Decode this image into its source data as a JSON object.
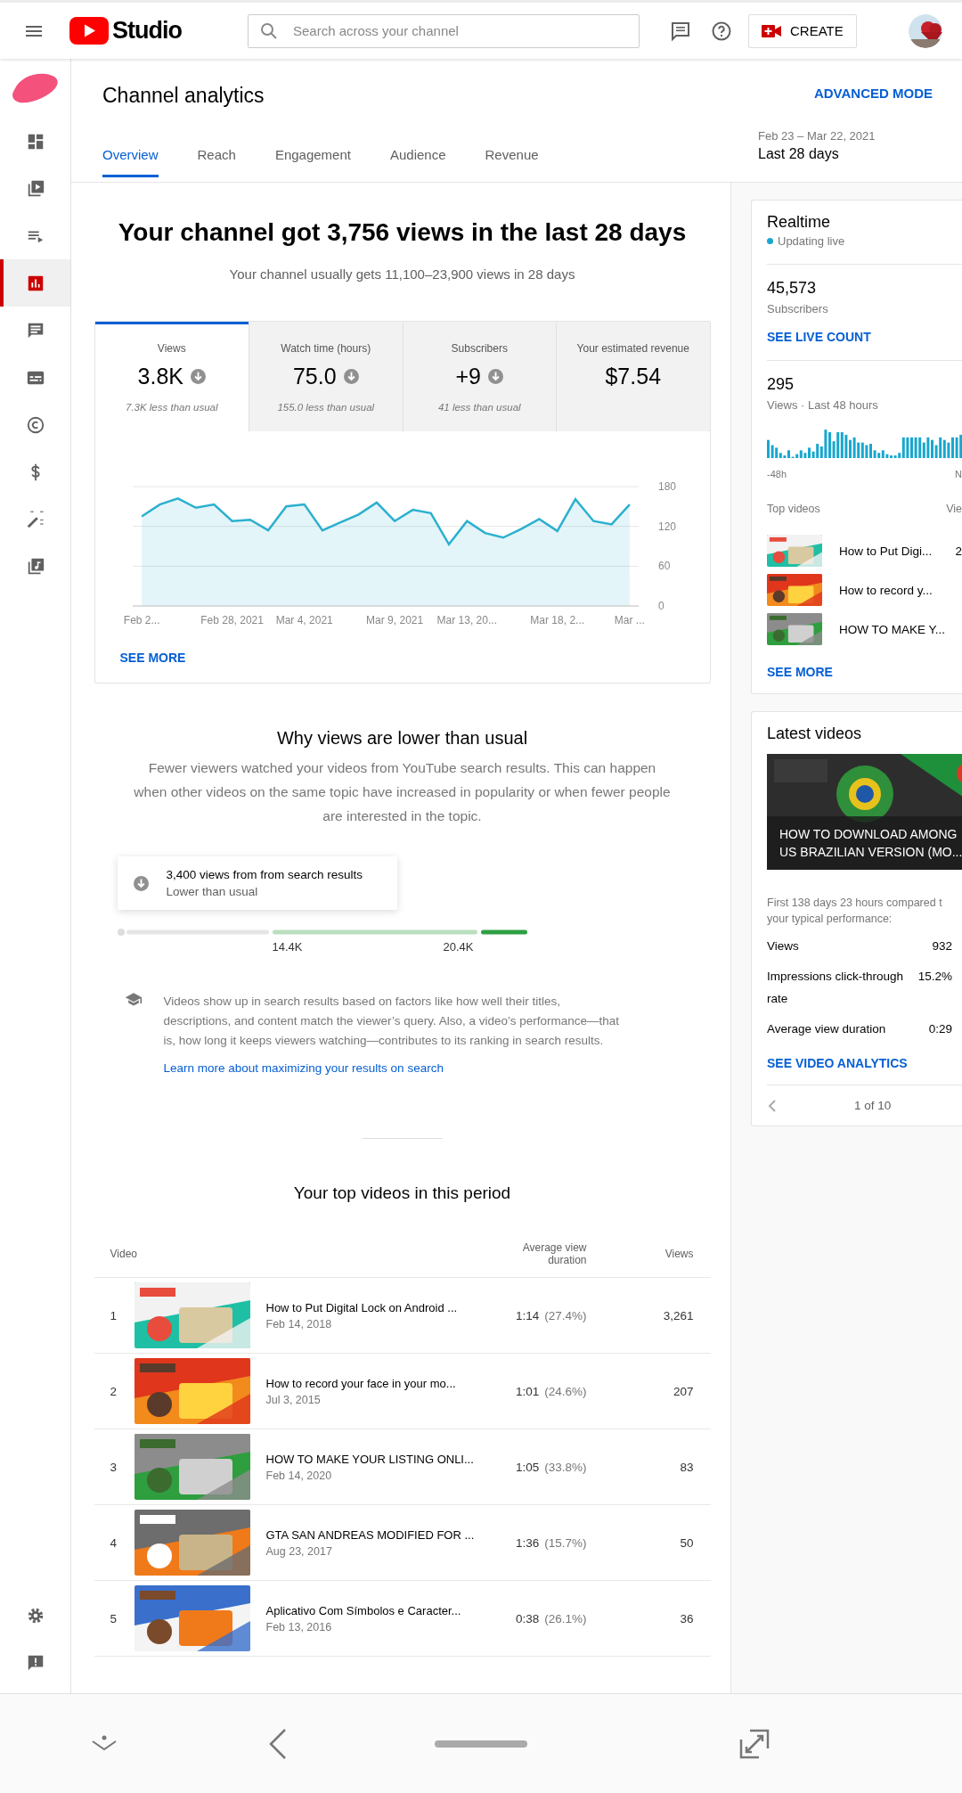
{
  "header": {
    "logo_text": "Studio",
    "search": {
      "placeholder": "Search across your channel"
    },
    "create_button": "CREATE"
  },
  "sidebar": {
    "items": [
      {
        "kind": "dashboard",
        "selected": false
      },
      {
        "kind": "content",
        "selected": false
      },
      {
        "kind": "playlists",
        "selected": false
      },
      {
        "kind": "analytics",
        "selected": true
      },
      {
        "kind": "comments",
        "selected": false
      },
      {
        "kind": "subtitles",
        "selected": false
      },
      {
        "kind": "copyright",
        "selected": false
      },
      {
        "kind": "monetization",
        "selected": false
      },
      {
        "kind": "customization",
        "selected": false
      },
      {
        "kind": "audio",
        "selected": false
      }
    ],
    "bottom_items": [
      {
        "kind": "settings"
      },
      {
        "kind": "feedback"
      }
    ]
  },
  "page": {
    "title": "Channel analytics",
    "advanced_mode": "ADVANCED MODE",
    "tabs": [
      {
        "label": "Overview",
        "selected": true
      },
      {
        "label": "Reach",
        "selected": false
      },
      {
        "label": "Engagement",
        "selected": false
      },
      {
        "label": "Audience",
        "selected": false
      },
      {
        "label": "Revenue",
        "selected": false
      }
    ],
    "date_range": "Feb 23 – Mar 22, 2021",
    "period": "Last 28 days"
  },
  "summary": {
    "headline": "Your channel got 3,756 views in the last 28 days",
    "subtitle": "Your channel usually gets 11,100–23,900 views in 28 days"
  },
  "metrics": {
    "tabs": [
      {
        "label": "Views",
        "value": "3.8K",
        "kind": "down_trend",
        "comparison": "7.3K less than usual",
        "selected": true
      },
      {
        "label": "Watch time (hours)",
        "value": "75.0",
        "kind": "down_trend",
        "comparison": "155.0 less than usual",
        "selected": false
      },
      {
        "label": "Subscribers",
        "value": "+9",
        "kind": "down_trend",
        "comparison": "41 less than usual",
        "selected": false
      },
      {
        "label": "Your estimated revenue",
        "value": "$7.54",
        "kind": "plain",
        "selected": false
      }
    ],
    "chart_data": {
      "type": "area",
      "ylim": [
        0,
        180
      ],
      "yticks": [
        0,
        60,
        120,
        180
      ],
      "categories": [
        "Feb 2...",
        null,
        null,
        null,
        null,
        "Feb 28, 2021",
        null,
        null,
        null,
        "Mar 4, 2021",
        null,
        null,
        null,
        null,
        "Mar 9, 2021",
        null,
        null,
        null,
        "Mar 13, 20...",
        null,
        null,
        null,
        null,
        "Mar 18, 2...",
        null,
        null,
        null,
        "Mar ..."
      ],
      "series": [
        {
          "color": "#2bb0cf",
          "values": [
            135,
            153,
            162,
            148,
            153,
            128,
            130,
            114,
            150,
            153,
            114,
            126,
            138,
            156,
            128,
            145,
            140,
            93,
            128,
            110,
            103,
            116,
            131,
            113,
            161,
            128,
            123,
            153
          ]
        }
      ]
    },
    "see_more": "SEE MORE"
  },
  "insight": {
    "title": "Why views are lower than usual",
    "body": "Fewer viewers watched your videos from YouTube search results. This can happen when other videos on the same topic have increased in popularity or when fewer people are interested in the topic.",
    "callout": {
      "title": "3,400 views from from search results",
      "subtitle": "Lower than usual"
    },
    "range_labels": [
      "14.4K",
      "20.4K"
    ],
    "tip": "Videos show up in search results based on factors like how well their titles, descriptions, and content match the viewer’s query. Also, a video’s performance—that is, how long it keeps viewers watching—contributes to its ranking in search results.",
    "link": "Learn more about maximizing your results on search"
  },
  "top_videos": {
    "title": "Your top videos in this period",
    "columns": [
      "Video",
      "Average view duration",
      "Views"
    ],
    "rows": [
      {
        "rank": "1",
        "title": "How to Put Digital Lock on Android ...",
        "date": "Feb 14, 2018",
        "duration": "1:14",
        "percent": "(27.4%)",
        "views": "3,261"
      },
      {
        "rank": "2",
        "title": "How to record your face in your mo...",
        "date": "Jul 3, 2015",
        "duration": "1:01",
        "percent": "(24.6%)",
        "views": "207"
      },
      {
        "rank": "3",
        "title": "HOW TO MAKE YOUR LISTING ONLI...",
        "date": "Feb 14, 2020",
        "duration": "1:05",
        "percent": "(33.8%)",
        "views": "83"
      },
      {
        "rank": "4",
        "title": "GTA SAN ANDREAS MODIFIED FOR ...",
        "date": "Aug 23, 2017",
        "duration": "1:36",
        "percent": "(15.7%)",
        "views": "50"
      },
      {
        "rank": "5",
        "title": "Aplicativo Com Símbolos e Caracter...",
        "date": "Feb 13, 2016",
        "duration": "0:38",
        "percent": "(26.1%)",
        "views": "36"
      }
    ]
  },
  "realtime": {
    "title": "Realtime",
    "status": "Updating live",
    "subscribers": "45,573",
    "subscribers_label": "Subscribers",
    "live_count": "SEE LIVE COUNT",
    "views": "295",
    "views_label": "Views · Last 48 hours",
    "axis_start": "-48h",
    "axis_end": "N",
    "top_videos_label": "Top videos",
    "views_column": "Vie",
    "top_videos": [
      {
        "title": "How to Put Digi...",
        "views": "2"
      },
      {
        "title": "How to record y..."
      },
      {
        "title": "HOW TO MAKE Y..."
      }
    ],
    "see_more": "SEE MORE"
  },
  "latest_videos": {
    "title": "Latest videos",
    "video_title": "HOW TO DOWNLOAD AMONG US BRAZILIAN VERSION (MO...",
    "note": "First 138 days 23 hours compared t your typical performance:",
    "stats": [
      {
        "label": "Views",
        "value": "932"
      },
      {
        "label": "Impressions click-through rate",
        "value": "15.2%"
      },
      {
        "label": "Average view duration",
        "value": "0:29"
      }
    ],
    "analytics_link": "SEE VIDEO ANALYTICS",
    "pager": "1 of 10"
  }
}
